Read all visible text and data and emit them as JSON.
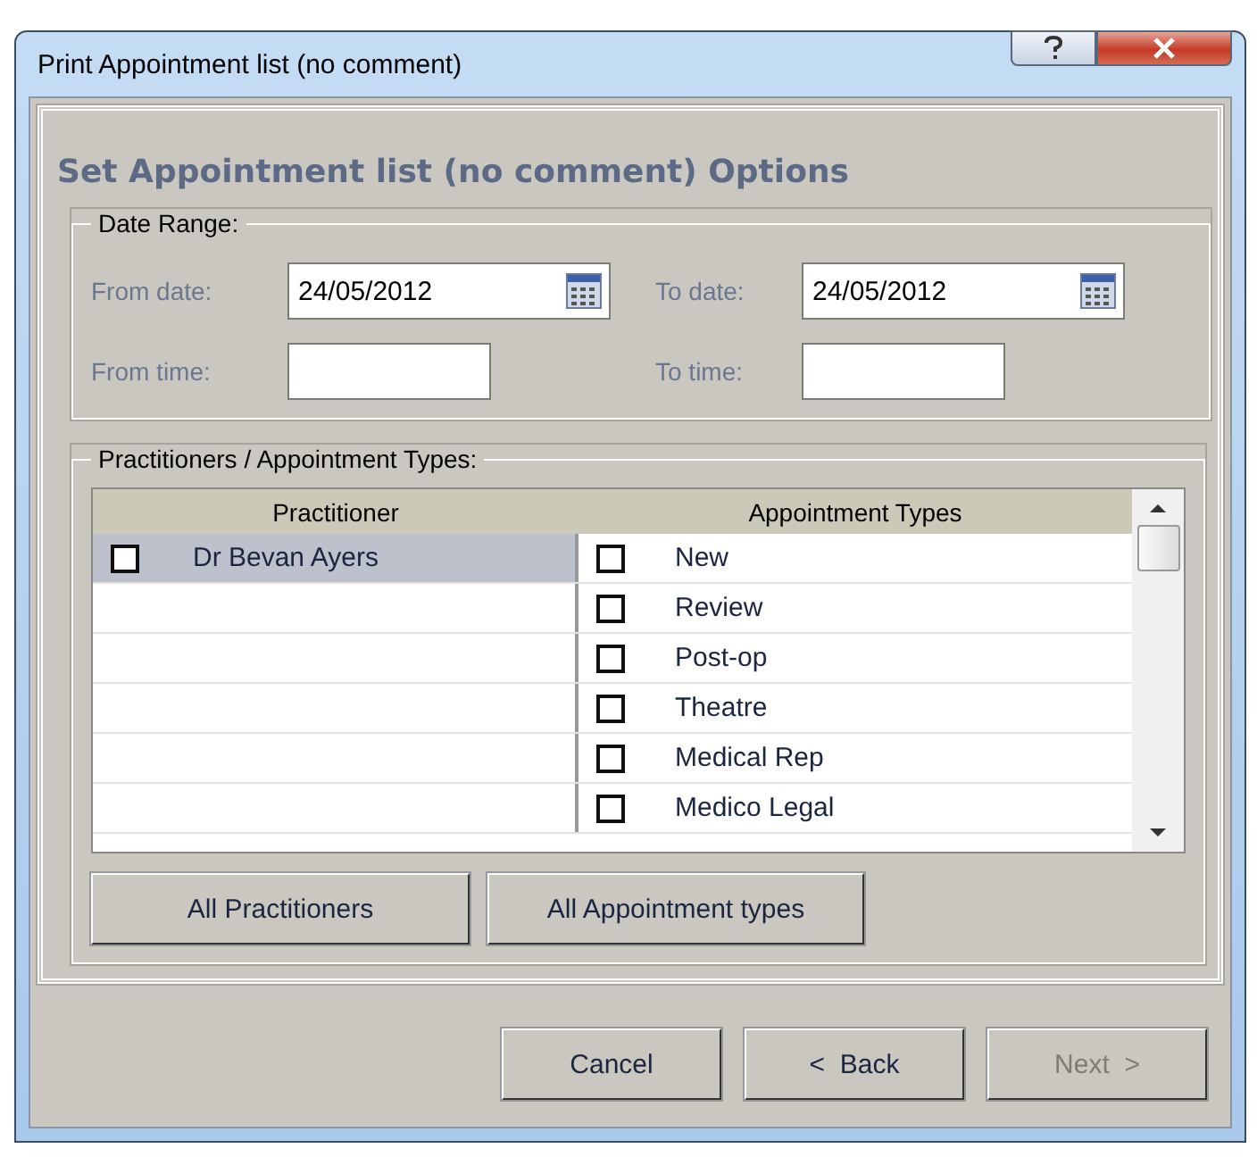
{
  "window": {
    "title": "Print Appointment list (no comment)"
  },
  "heading": "Set Appointment list (no comment) Options",
  "date_range": {
    "legend": "Date Range:",
    "fields": [
      {
        "label": "From date:",
        "value": "24/05/2012",
        "kind": "date"
      },
      {
        "label": "To date:",
        "value": "24/05/2012",
        "kind": "date"
      },
      {
        "label": "From time:",
        "kind": "time"
      },
      {
        "label": "To time:",
        "kind": "time"
      }
    ]
  },
  "practitioners": {
    "legend": "Practitioners / Appointment Types:",
    "columns": [
      "Practitioner",
      "Appointment Types"
    ],
    "rows": [
      {
        "practitioner": {
          "name": "Dr Bevan Ayers",
          "checked": false,
          "selected": true
        },
        "type": {
          "name": "New",
          "checked": false
        }
      },
      {
        "type": {
          "name": "Review",
          "checked": false
        }
      },
      {
        "type": {
          "name": "Post-op",
          "checked": false
        }
      },
      {
        "type": {
          "name": "Theatre",
          "checked": false
        }
      },
      {
        "type": {
          "name": "Medical Rep",
          "checked": false
        }
      },
      {
        "type": {
          "name": "Medico Legal",
          "checked": false
        }
      }
    ],
    "buttons": [
      "All Practitioners",
      "All Appointment types"
    ]
  },
  "footer_buttons": [
    {
      "label": "Cancel",
      "disabled": false
    },
    {
      "label": "<  Back",
      "disabled": false
    },
    {
      "label": "Next  >",
      "disabled": true
    }
  ]
}
